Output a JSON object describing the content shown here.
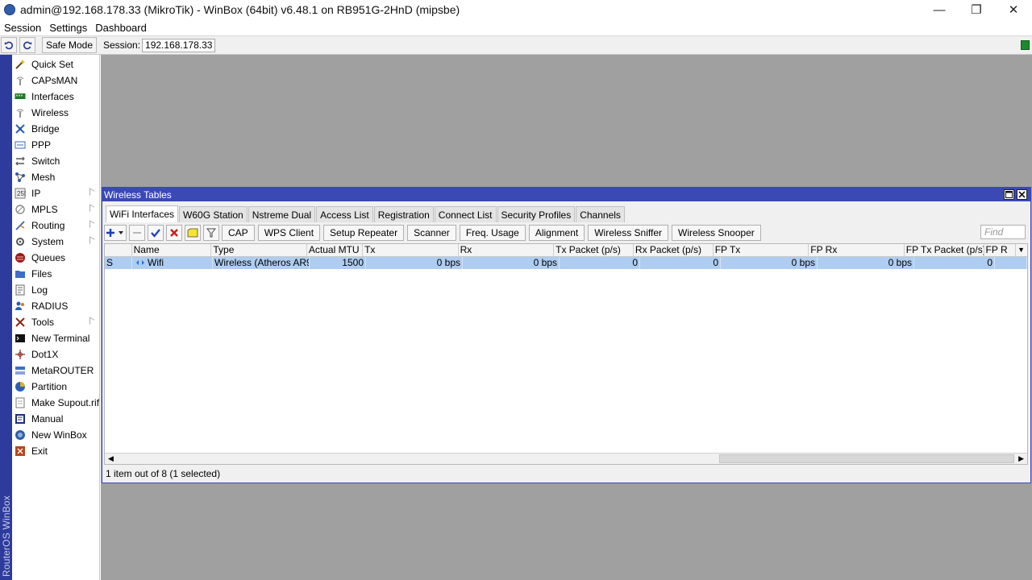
{
  "window": {
    "title": "admin@192.168.178.33 (MikroTik) - WinBox (64bit) v6.48.1 on RB951G-2HnD (mipsbe)",
    "minimize": "—",
    "restore": "❐",
    "close": "✕"
  },
  "menu": [
    "Session",
    "Settings",
    "Dashboard"
  ],
  "toolbar": {
    "undo_icon": "undo-icon",
    "redo_icon": "redo-icon",
    "safe_mode": "Safe Mode",
    "session_label": "Session:",
    "session_value": "192.168.178.33",
    "status_color": "#1c8a2c"
  },
  "vertical_label": "RouterOS WinBox",
  "sidebar": {
    "items": [
      {
        "label": "Quick Set",
        "icon": "wand-icon",
        "sub": false
      },
      {
        "label": "CAPsMAN",
        "icon": "antenna-icon",
        "sub": false
      },
      {
        "label": "Interfaces",
        "icon": "interfaces-icon",
        "sub": false
      },
      {
        "label": "Wireless",
        "icon": "wireless-icon",
        "sub": false
      },
      {
        "label": "Bridge",
        "icon": "bridge-icon",
        "sub": false
      },
      {
        "label": "PPP",
        "icon": "ppp-icon",
        "sub": false
      },
      {
        "label": "Switch",
        "icon": "switch-icon",
        "sub": false
      },
      {
        "label": "Mesh",
        "icon": "mesh-icon",
        "sub": false
      },
      {
        "label": "IP",
        "icon": "ip-icon",
        "sub": true
      },
      {
        "label": "MPLS",
        "icon": "mpls-icon",
        "sub": true
      },
      {
        "label": "Routing",
        "icon": "routing-icon",
        "sub": true
      },
      {
        "label": "System",
        "icon": "system-icon",
        "sub": true
      },
      {
        "label": "Queues",
        "icon": "queues-icon",
        "sub": false
      },
      {
        "label": "Files",
        "icon": "files-icon",
        "sub": false
      },
      {
        "label": "Log",
        "icon": "log-icon",
        "sub": false
      },
      {
        "label": "RADIUS",
        "icon": "radius-icon",
        "sub": false
      },
      {
        "label": "Tools",
        "icon": "tools-icon",
        "sub": true
      },
      {
        "label": "New Terminal",
        "icon": "terminal-icon",
        "sub": false
      },
      {
        "label": "Dot1X",
        "icon": "dot1x-icon",
        "sub": false
      },
      {
        "label": "MetaROUTER",
        "icon": "metarouter-icon",
        "sub": false
      },
      {
        "label": "Partition",
        "icon": "partition-icon",
        "sub": false
      },
      {
        "label": "Make Supout.rif",
        "icon": "supout-icon",
        "sub": false
      },
      {
        "label": "Manual",
        "icon": "manual-icon",
        "sub": false
      },
      {
        "label": "New WinBox",
        "icon": "winbox-icon",
        "sub": false
      },
      {
        "label": "Exit",
        "icon": "exit-icon",
        "sub": false
      }
    ]
  },
  "wireless_window": {
    "title": "Wireless Tables",
    "tabs": [
      {
        "label": "WiFi Interfaces",
        "active": true
      },
      {
        "label": "W60G Station",
        "active": false
      },
      {
        "label": "Nstreme Dual",
        "active": false
      },
      {
        "label": "Access List",
        "active": false
      },
      {
        "label": "Registration",
        "active": false
      },
      {
        "label": "Connect List",
        "active": false
      },
      {
        "label": "Security Profiles",
        "active": false
      },
      {
        "label": "Channels",
        "active": false
      }
    ],
    "buttons": [
      "CAP",
      "WPS Client",
      "Setup Repeater",
      "Scanner",
      "Freq. Usage",
      "Alignment",
      "Wireless Sniffer",
      "Wireless Snooper"
    ],
    "find_placeholder": "Find",
    "columns": [
      "",
      "Name",
      "Type",
      "Actual MTU",
      "Tx",
      "Rx",
      "Tx Packet (p/s)",
      "Rx Packet (p/s)",
      "FP Tx",
      "FP Rx",
      "FP Tx Packet (p/s)",
      "FP R"
    ],
    "rows": [
      [
        "S",
        "Wifi",
        "Wireless (Atheros AR9...",
        "1500",
        "0 bps",
        "0 bps",
        "0",
        "0",
        "0 bps",
        "0 bps",
        "0",
        ""
      ]
    ],
    "status": "1 item out of 8 (1 selected)"
  }
}
